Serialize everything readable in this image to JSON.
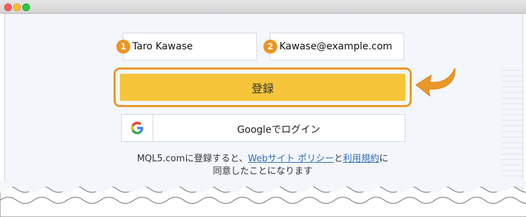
{
  "window": {
    "traffic_lights": [
      "close",
      "minimize",
      "maximize"
    ]
  },
  "form": {
    "name_badge": "1",
    "name_value": "Taro Kawase",
    "email_badge": "2",
    "email_value": "Kawase@example.com",
    "register_label": "登録",
    "google_label": "Googleでログイン",
    "google_icon": "google-g-icon"
  },
  "terms": {
    "prefix": "MQL5.comに登録すると、",
    "link_web": "Webサイト ポリシー",
    "and": "と",
    "link_terms": "利用規約",
    "suffix": "に",
    "line2": "同意したことになります"
  },
  "colors": {
    "accent_orange": "#eb9728",
    "button_yellow": "#f6c53a",
    "link_blue": "#2f6eb5"
  }
}
